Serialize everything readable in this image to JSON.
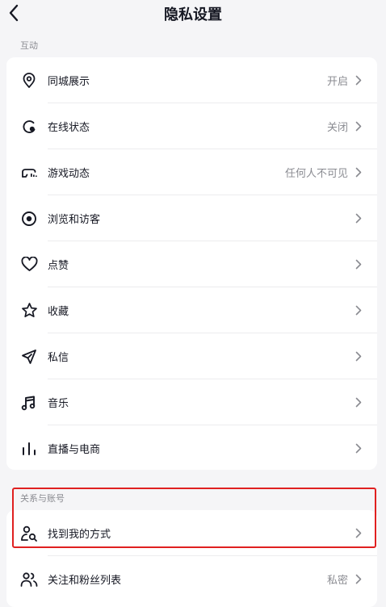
{
  "header": {
    "title": "隐私设置"
  },
  "sections": {
    "interaction": {
      "label": "互动",
      "items": [
        {
          "label": "同城展示",
          "value": "开启",
          "icon": "location-pin-icon"
        },
        {
          "label": "在线状态",
          "value": "关闭",
          "icon": "online-status-icon"
        },
        {
          "label": "游戏动态",
          "value": "任何人不可见",
          "icon": "game-controller-icon"
        },
        {
          "label": "浏览和访客",
          "value": "",
          "icon": "eye-icon"
        },
        {
          "label": "点赞",
          "value": "",
          "icon": "heart-icon"
        },
        {
          "label": "收藏",
          "value": "",
          "icon": "star-icon"
        },
        {
          "label": "私信",
          "value": "",
          "icon": "paper-plane-icon"
        },
        {
          "label": "音乐",
          "value": "",
          "icon": "music-note-icon"
        },
        {
          "label": "直播与电商",
          "value": "",
          "icon": "live-bars-icon"
        }
      ]
    },
    "relations": {
      "label": "关系与账号",
      "items": [
        {
          "label": "找到我的方式",
          "value": "",
          "icon": "find-person-icon"
        },
        {
          "label": "关注和粉丝列表",
          "value": "私密",
          "icon": "followers-icon"
        }
      ]
    }
  }
}
